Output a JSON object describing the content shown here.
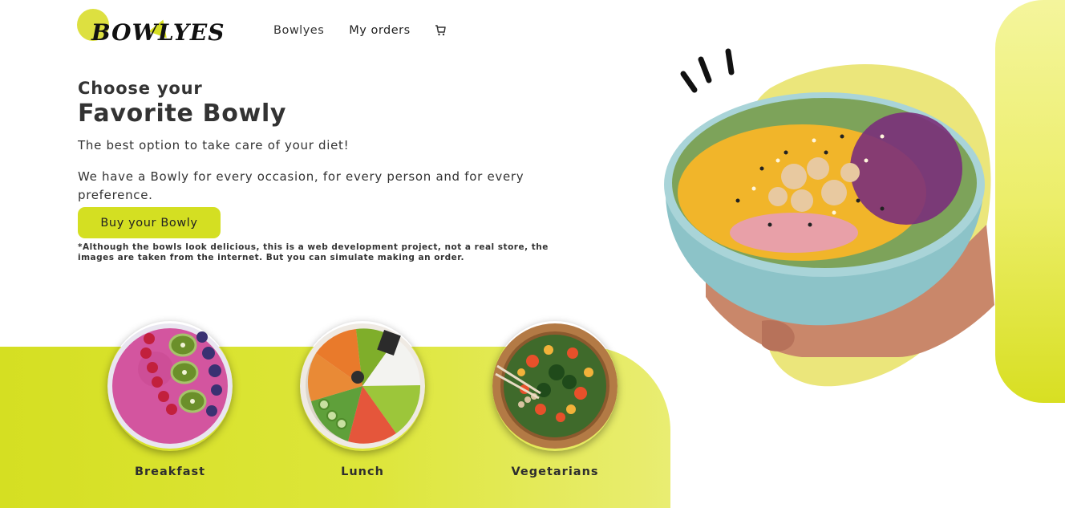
{
  "header": {
    "logo_text": "BOWLYES",
    "nav": {
      "bowlyes_label": "Bowlyes",
      "orders_label": "My orders",
      "cart_icon": "cart-icon"
    }
  },
  "hero": {
    "kicker": "Choose your",
    "title": "Favorite Bowly",
    "subtitle": "The best option to take care of your diet!",
    "description": "We have a Bowly for every occasion, for every person and for every preference.",
    "buy_button": "Buy your Bowly",
    "disclaimer": "*Although the bowls look delicious, this is a web development project, not a real store, the images are taken from the internet. But you can simulate making an order."
  },
  "categories": [
    {
      "label": "Breakfast"
    },
    {
      "label": "Lunch"
    },
    {
      "label": "Vegetarians"
    }
  ],
  "colors": {
    "accent": "#d4df22",
    "accent_light": "#f4f59c",
    "text": "#333333"
  }
}
